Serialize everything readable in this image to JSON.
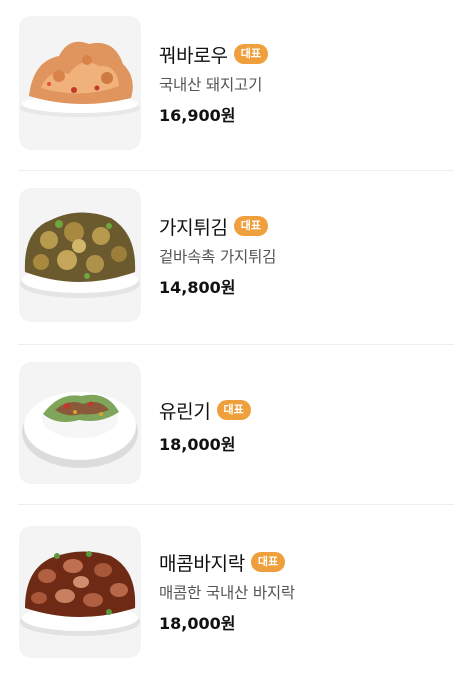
{
  "menu": {
    "items": [
      {
        "name": "꿔바로우",
        "badge": "대표",
        "description": "국내산 돼지고기",
        "price": "16,900원",
        "image": "fried-pork-image"
      },
      {
        "name": "가지튀김",
        "badge": "대표",
        "description": "겉바속촉 가지튀김",
        "price": "14,800원",
        "image": "fried-eggplant-image"
      },
      {
        "name": "유린기",
        "badge": "대표",
        "description": "",
        "price": "18,000원",
        "image": "yuringi-image"
      },
      {
        "name": "매콤바지락",
        "badge": "대표",
        "description": "매콤한 국내산 바지락",
        "price": "18,000원",
        "image": "spicy-clam-image"
      }
    ]
  },
  "colors": {
    "badge": "#ef9f3c",
    "thumb_bg": "#f4f4f4",
    "divider": "#eeeeee",
    "desc_text": "#555555"
  }
}
